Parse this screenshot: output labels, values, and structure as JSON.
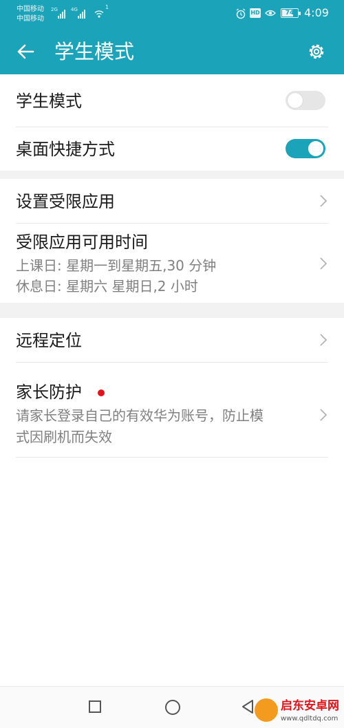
{
  "status_bar": {
    "carrier_1": "中国移动",
    "carrier_2": "中国移动",
    "network_1": "2G",
    "network_2": "4G",
    "wifi_badge": "1",
    "hd_badge": "HD",
    "battery_level": "74",
    "battery_fraction": 0.74,
    "time": "4:09"
  },
  "app_bar": {
    "title": "学生模式",
    "back_icon": "arrow-left-icon",
    "settings_icon": "gear-icon"
  },
  "settings": {
    "student_mode": {
      "label": "学生模式",
      "enabled": false
    },
    "desktop_shortcut": {
      "label": "桌面快捷方式",
      "enabled": true
    },
    "restricted_apps": {
      "label": "设置受限应用"
    },
    "restricted_time": {
      "label": "受限应用可用时间",
      "school_days": "上课日: 星期一到星期五,30 分钟",
      "rest_days": "休息日: 星期六 星期日,2 小时"
    },
    "remote_location": {
      "label": "远程定位"
    },
    "parent_protection": {
      "label": "家长防护",
      "description_line_1": "请家长登录自己的有效华为账号，防止模",
      "description_line_2": "式因刷机而失效"
    }
  },
  "nav_bar": {
    "recent_icon": "square-icon",
    "home_icon": "circle-icon",
    "back_icon": "triangle-back-icon"
  },
  "watermark": {
    "text": "启东安卓网",
    "url": "www.qdltdq.com"
  },
  "colors": {
    "accent": "#1ba3b9",
    "badge_red": "#e0151c"
  }
}
